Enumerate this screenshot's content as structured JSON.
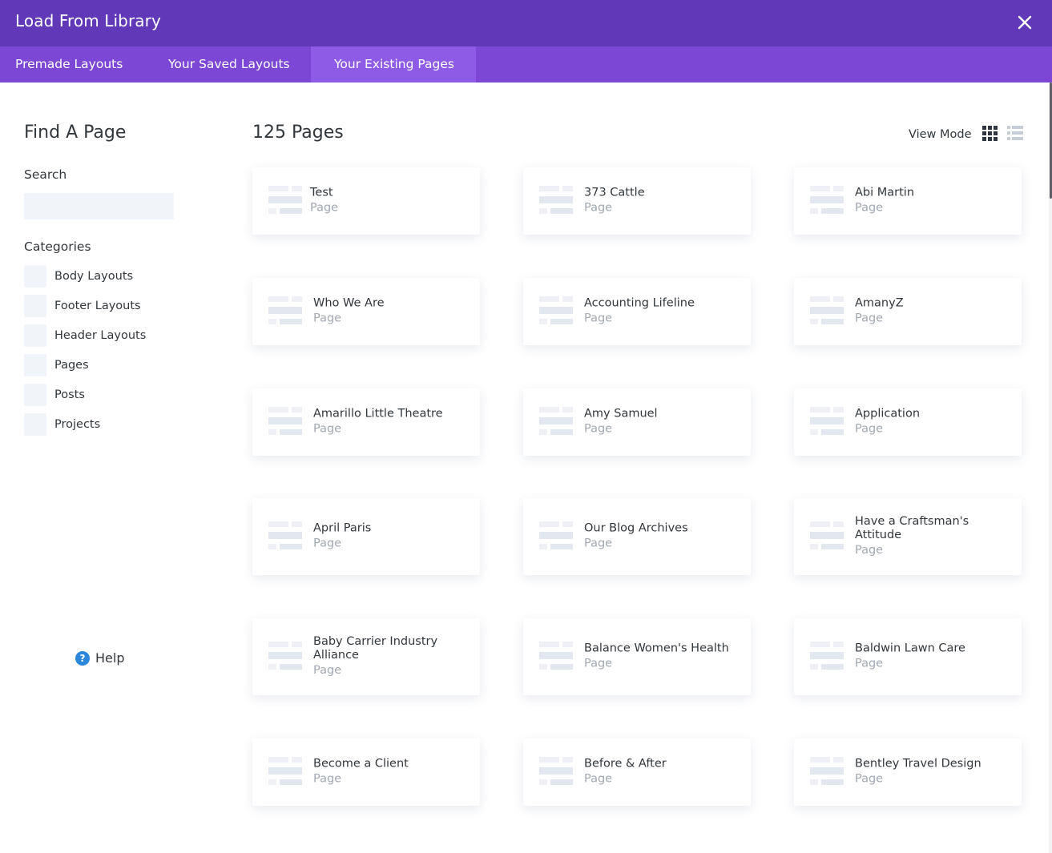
{
  "modal": {
    "title": "Load From Library"
  },
  "tabs": [
    {
      "label": "Premade Layouts",
      "active": false
    },
    {
      "label": "Your Saved Layouts",
      "active": false
    },
    {
      "label": "Your Existing Pages",
      "active": true
    }
  ],
  "sidebar": {
    "title": "Find A Page",
    "search_label": "Search",
    "search_placeholder": "",
    "categories_label": "Categories",
    "categories": [
      "Body Layouts",
      "Footer Layouts",
      "Header Layouts",
      "Pages",
      "Posts",
      "Projects"
    ],
    "help_label": "Help"
  },
  "main": {
    "count_label": "125 Pages",
    "view_mode_label": "View Mode",
    "view_mode": "grid",
    "pages": [
      {
        "title": "Test",
        "type": "Page"
      },
      {
        "title": "373 Cattle",
        "type": "Page"
      },
      {
        "title": "Abi Martin",
        "type": "Page"
      },
      {
        "title": "Who We Are",
        "type": "Page"
      },
      {
        "title": "Accounting Lifeline",
        "type": "Page"
      },
      {
        "title": "AmanyZ",
        "type": "Page"
      },
      {
        "title": "Amarillo Little Theatre",
        "type": "Page"
      },
      {
        "title": "Amy Samuel",
        "type": "Page"
      },
      {
        "title": "Application",
        "type": "Page"
      },
      {
        "title": "April Paris",
        "type": "Page"
      },
      {
        "title": "Our Blog Archives",
        "type": "Page"
      },
      {
        "title": "Have a Craftsman's Attitude",
        "type": "Page"
      },
      {
        "title": "Baby Carrier Industry Alliance",
        "type": "Page"
      },
      {
        "title": "Balance Women's Health",
        "type": "Page"
      },
      {
        "title": "Baldwin Lawn Care",
        "type": "Page"
      },
      {
        "title": "Become a Client",
        "type": "Page"
      },
      {
        "title": "Before & After",
        "type": "Page"
      },
      {
        "title": "Bentley Travel Design",
        "type": "Page"
      }
    ]
  },
  "colors": {
    "header_bg": "#6038b8",
    "tab_bar_bg": "#7b47d4",
    "active_tab_bg": "#8d5be6",
    "help_icon": "#2b87da"
  }
}
